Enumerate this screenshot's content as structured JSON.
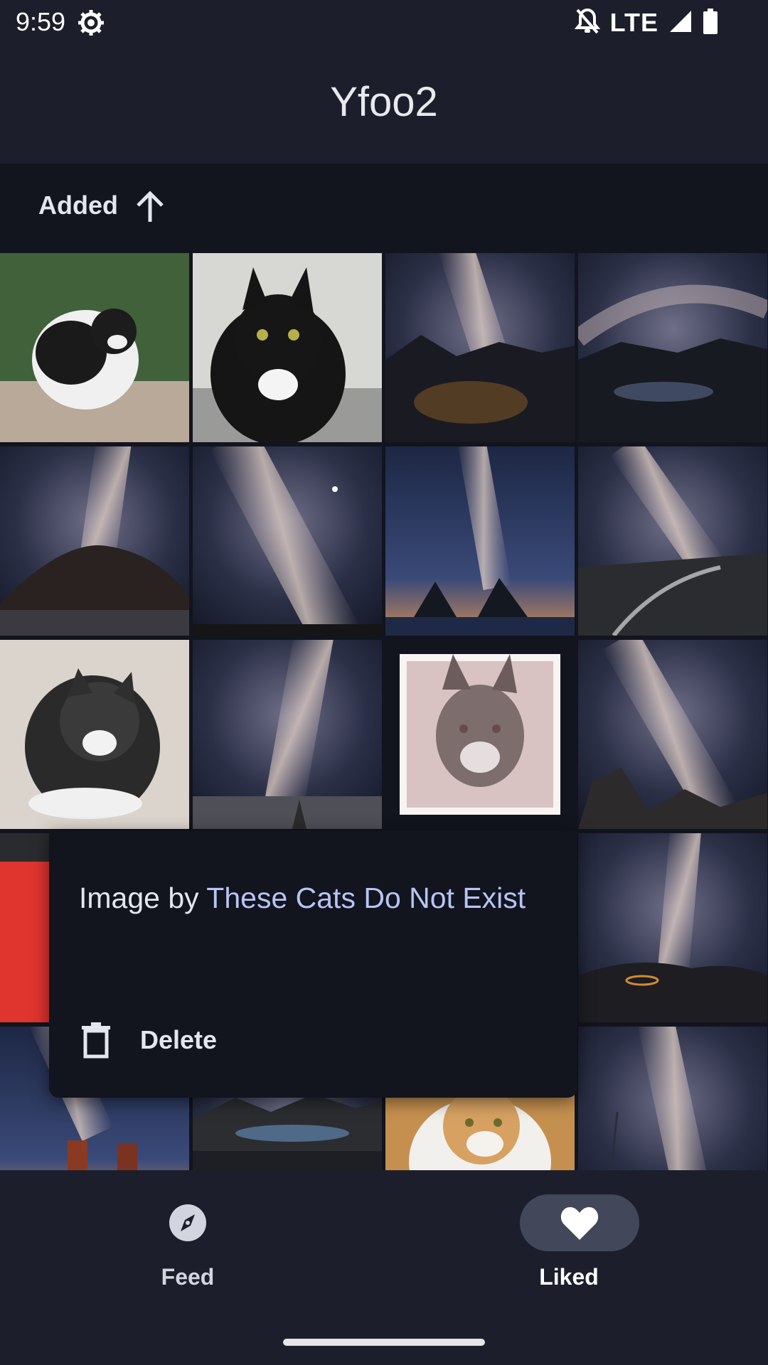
{
  "status_bar": {
    "time": "9:59",
    "network": "LTE",
    "icons": [
      "settings-icon",
      "mute-bell-icon",
      "signal-icon",
      "battery-icon"
    ]
  },
  "app": {
    "title": "Yfoo2"
  },
  "sort": {
    "label": "Added",
    "direction_icon": "arrow-up-icon"
  },
  "grid": {
    "tiles": [
      "cat-black-white-garden",
      "cat-black-white-portrait",
      "milky-way-rocky-coast",
      "milky-way-arch-lakes",
      "milky-way-mountain-snow",
      "milky-way-bright-stars",
      "milky-way-sea-rocks",
      "milky-way-winding-road",
      "cat-black-white-lying",
      "milky-way-vertical-plain",
      "cat-framed-kitten",
      "milky-way-rocky-peaks",
      "cat-colorful-partial",
      "milky-way-hills-lights",
      "milky-way-rock-pillars",
      "milky-way-mountain-lake",
      "cat-orange-white",
      "milky-way-starry-column"
    ]
  },
  "context_menu": {
    "credit_prefix": "Image by ",
    "credit_link": "These Cats Do Not Exist",
    "delete_label": "Delete"
  },
  "bottom_nav": {
    "items": [
      {
        "label": "Feed",
        "icon": "compass-icon",
        "active": false
      },
      {
        "label": "Liked",
        "icon": "heart-icon",
        "active": true
      }
    ]
  },
  "colors": {
    "background": "#1c1f2b",
    "surface_dark": "#12141e",
    "accent_link": "#b7c4f4",
    "active_pill": "#424759"
  }
}
